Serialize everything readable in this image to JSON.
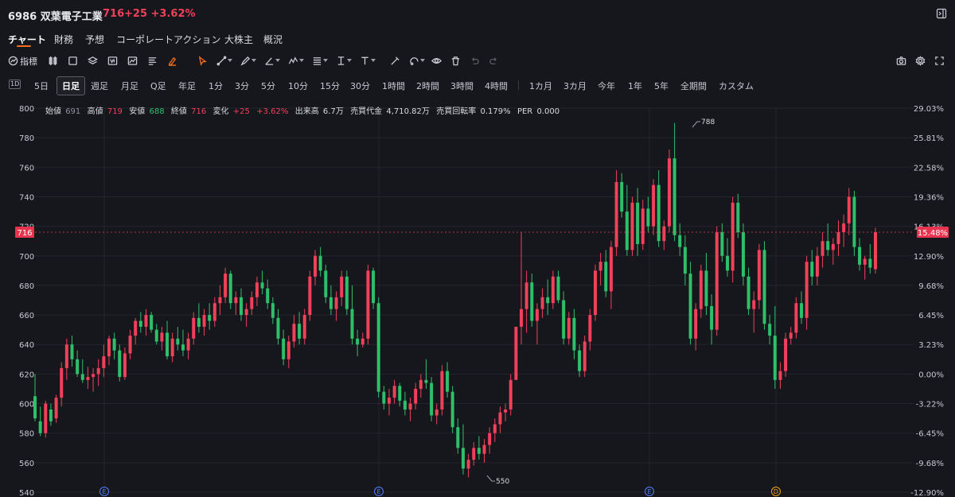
{
  "header": {
    "title": "6986 双葉電子工業",
    "price": "716",
    "change": "+25",
    "change_pct": "+3.62%"
  },
  "tabs": [
    {
      "label": "チャート",
      "active": true
    },
    {
      "label": "財務"
    },
    {
      "label": "予想"
    },
    {
      "label": "コーポレートアクション"
    },
    {
      "label": "大株主"
    },
    {
      "label": "概況"
    }
  ],
  "toolbar": {
    "indicator_label": "指標",
    "icons": [
      "indicator-icon",
      "candle-type-icon",
      "rectangle-icon",
      "layers-icon",
      "template-icon",
      "compare-icon",
      "text-list-icon",
      "brush-icon",
      "cursor-icon",
      "trendline-icon",
      "pen-icon",
      "angle-icon",
      "pattern-icon",
      "fib-icon",
      "measure-icon",
      "text-tool-icon",
      "draw-icon",
      "eye-icon",
      "trash-icon",
      "undo-icon",
      "redo-icon"
    ],
    "right_icons": [
      "camera-icon",
      "settings-icon",
      "fullscreen-icon"
    ]
  },
  "periods": {
    "badge": "1D",
    "items": [
      "5日",
      "日足",
      "週足",
      "月足",
      "Q足",
      "年足",
      "1分",
      "3分",
      "5分",
      "10分",
      "15分",
      "30分",
      "1時間",
      "2時間",
      "3時間",
      "4時間",
      "1カ月",
      "3カ月",
      "今年",
      "1年",
      "5年",
      "全期間",
      "カスタム"
    ],
    "active": "日足"
  },
  "ohlc": {
    "open_label": "始値",
    "open": "691",
    "high_label": "高値",
    "high": "719",
    "low_label": "安値",
    "low": "688",
    "close_label": "終値",
    "close": "716",
    "change_label": "変化",
    "change": "+25",
    "change_pct": "+3.62%",
    "volume_label": "出来高",
    "volume": "6.7万",
    "turnover_label": "売買代金",
    "turnover": "4,710.82万",
    "turnover_rate_label": "売買回転率",
    "turnover_rate": "0.179%",
    "per_label": "PER",
    "per": "0.000"
  },
  "chart_data": {
    "type": "candlestick",
    "y_ticks": [
      800,
      780,
      760,
      740,
      720,
      700,
      680,
      660,
      640,
      620,
      600,
      580,
      560,
      540
    ],
    "pct_ticks": [
      "29.03%",
      "25.81%",
      "22.58%",
      "19.36%",
      "16.13%",
      "12.90%",
      "9.68%",
      "6.45%",
      "3.23%",
      "0.00%",
      "-3.22%",
      "-6.45%",
      "-9.68%",
      "-12.90%"
    ],
    "ylim": [
      540,
      800
    ],
    "current_price": 716,
    "current_label": "716",
    "current_pct": "15.48%",
    "high_marker": "788",
    "low_marker": "550",
    "event_markers": [
      "E",
      "E",
      "E",
      "D"
    ],
    "colors": {
      "up": "#f0405a",
      "down": "#2fbf6a",
      "bg": "#16171c",
      "grid": "#23252c"
    },
    "candles": [
      [
        605,
        620,
        588,
        590
      ],
      [
        588,
        598,
        578,
        580
      ],
      [
        580,
        602,
        577,
        600
      ],
      [
        596,
        600,
        585,
        588
      ],
      [
        590,
        606,
        587,
        604
      ],
      [
        604,
        628,
        598,
        624
      ],
      [
        624,
        644,
        616,
        640
      ],
      [
        640,
        646,
        625,
        630
      ],
      [
        630,
        636,
        618,
        620
      ],
      [
        620,
        630,
        614,
        616
      ],
      [
        616,
        625,
        610,
        618
      ],
      [
        618,
        624,
        608,
        620
      ],
      [
        620,
        630,
        612,
        624
      ],
      [
        624,
        640,
        618,
        632
      ],
      [
        632,
        646,
        626,
        644
      ],
      [
        644,
        648,
        630,
        636
      ],
      [
        636,
        640,
        615,
        618
      ],
      [
        618,
        638,
        616,
        634
      ],
      [
        634,
        650,
        630,
        646
      ],
      [
        646,
        658,
        640,
        656
      ],
      [
        656,
        662,
        648,
        652
      ],
      [
        652,
        664,
        646,
        660
      ],
      [
        660,
        662,
        648,
        650
      ],
      [
        650,
        654,
        640,
        642
      ],
      [
        642,
        652,
        636,
        648
      ],
      [
        648,
        656,
        630,
        632
      ],
      [
        632,
        648,
        628,
        644
      ],
      [
        644,
        652,
        636,
        640
      ],
      [
        640,
        650,
        632,
        636
      ],
      [
        636,
        648,
        630,
        644
      ],
      [
        644,
        662,
        640,
        658
      ],
      [
        658,
        668,
        648,
        652
      ],
      [
        652,
        664,
        646,
        660
      ],
      [
        660,
        668,
        650,
        656
      ],
      [
        656,
        672,
        652,
        668
      ],
      [
        668,
        680,
        660,
        672
      ],
      [
        672,
        692,
        668,
        688
      ],
      [
        688,
        690,
        664,
        668
      ],
      [
        668,
        676,
        660,
        672
      ],
      [
        672,
        678,
        656,
        660
      ],
      [
        660,
        668,
        652,
        664
      ],
      [
        664,
        676,
        660,
        672
      ],
      [
        672,
        686,
        666,
        682
      ],
      [
        682,
        690,
        674,
        678
      ],
      [
        678,
        684,
        664,
        668
      ],
      [
        668,
        672,
        654,
        658
      ],
      [
        658,
        664,
        640,
        644
      ],
      [
        644,
        650,
        626,
        630
      ],
      [
        630,
        646,
        624,
        642
      ],
      [
        642,
        660,
        638,
        654
      ],
      [
        654,
        662,
        640,
        644
      ],
      [
        644,
        664,
        640,
        660
      ],
      [
        660,
        690,
        656,
        686
      ],
      [
        686,
        704,
        680,
        700
      ],
      [
        700,
        706,
        686,
        690
      ],
      [
        690,
        694,
        668,
        672
      ],
      [
        672,
        680,
        660,
        664
      ],
      [
        664,
        676,
        656,
        672
      ],
      [
        672,
        690,
        666,
        686
      ],
      [
        686,
        690,
        660,
        664
      ],
      [
        664,
        680,
        640,
        644
      ],
      [
        644,
        650,
        632,
        640
      ],
      [
        640,
        648,
        638,
        644
      ],
      [
        644,
        694,
        640,
        690
      ],
      [
        690,
        692,
        664,
        668
      ],
      [
        668,
        672,
        604,
        608
      ],
      [
        608,
        612,
        596,
        600
      ],
      [
        600,
        610,
        592,
        604
      ],
      [
        604,
        616,
        600,
        612
      ],
      [
        612,
        614,
        598,
        602
      ],
      [
        602,
        608,
        592,
        596
      ],
      [
        596,
        604,
        588,
        600
      ],
      [
        600,
        614,
        596,
        610
      ],
      [
        610,
        620,
        604,
        616
      ],
      [
        616,
        630,
        610,
        614
      ],
      [
        614,
        618,
        588,
        592
      ],
      [
        592,
        600,
        586,
        596
      ],
      [
        596,
        626,
        592,
        622
      ],
      [
        622,
        628,
        604,
        608
      ],
      [
        608,
        612,
        580,
        584
      ],
      [
        584,
        590,
        566,
        570
      ],
      [
        570,
        586,
        552,
        556
      ],
      [
        556,
        566,
        550,
        562
      ],
      [
        562,
        574,
        558,
        570
      ],
      [
        570,
        578,
        562,
        566
      ],
      [
        566,
        576,
        560,
        572
      ],
      [
        572,
        584,
        566,
        580
      ],
      [
        580,
        590,
        574,
        586
      ],
      [
        586,
        598,
        580,
        594
      ],
      [
        594,
        600,
        588,
        596
      ],
      [
        596,
        620,
        592,
        616
      ],
      [
        616,
        626,
        640,
        652
      ],
      [
        652,
        716,
        640,
        664
      ],
      [
        664,
        690,
        648,
        682
      ],
      [
        682,
        688,
        652,
        656
      ],
      [
        656,
        668,
        640,
        664
      ],
      [
        664,
        678,
        658,
        672
      ],
      [
        672,
        684,
        660,
        668
      ],
      [
        668,
        690,
        664,
        686
      ],
      [
        686,
        690,
        668,
        670
      ],
      [
        670,
        676,
        640,
        644
      ],
      [
        644,
        662,
        640,
        658
      ],
      [
        658,
        664,
        630,
        636
      ],
      [
        636,
        640,
        618,
        622
      ],
      [
        622,
        646,
        618,
        642
      ],
      [
        642,
        664,
        636,
        660
      ],
      [
        660,
        694,
        656,
        690
      ],
      [
        690,
        702,
        680,
        696
      ],
      [
        696,
        704,
        672,
        676
      ],
      [
        676,
        710,
        664,
        706
      ],
      [
        706,
        758,
        700,
        750
      ],
      [
        750,
        756,
        726,
        730
      ],
      [
        730,
        748,
        700,
        704
      ],
      [
        704,
        740,
        700,
        736
      ],
      [
        736,
        746,
        700,
        708
      ],
      [
        708,
        738,
        704,
        732
      ],
      [
        732,
        740,
        716,
        720
      ],
      [
        720,
        752,
        714,
        748
      ],
      [
        748,
        758,
        706,
        710
      ],
      [
        710,
        724,
        704,
        720
      ],
      [
        720,
        772,
        716,
        766
      ],
      [
        766,
        790,
        710,
        714
      ],
      [
        714,
        722,
        700,
        706
      ],
      [
        706,
        714,
        680,
        688
      ],
      [
        688,
        696,
        640,
        644
      ],
      [
        644,
        668,
        636,
        664
      ],
      [
        664,
        694,
        658,
        690
      ],
      [
        690,
        702,
        660,
        666
      ],
      [
        666,
        674,
        640,
        650
      ],
      [
        650,
        720,
        646,
        716
      ],
      [
        716,
        722,
        696,
        700
      ],
      [
        700,
        712,
        686,
        690
      ],
      [
        690,
        740,
        682,
        736
      ],
      [
        736,
        742,
        712,
        716
      ],
      [
        716,
        722,
        680,
        686
      ],
      [
        686,
        692,
        660,
        664
      ],
      [
        664,
        676,
        648,
        670
      ],
      [
        670,
        708,
        664,
        704
      ],
      [
        704,
        710,
        650,
        654
      ],
      [
        654,
        660,
        640,
        646
      ],
      [
        646,
        666,
        610,
        616
      ],
      [
        616,
        628,
        610,
        622
      ],
      [
        622,
        648,
        618,
        644
      ],
      [
        644,
        652,
        640,
        648
      ],
      [
        648,
        672,
        644,
        668
      ],
      [
        668,
        676,
        654,
        658
      ],
      [
        658,
        700,
        650,
        696
      ],
      [
        696,
        704,
        680,
        686
      ],
      [
        686,
        706,
        680,
        700
      ],
      [
        700,
        716,
        692,
        710
      ],
      [
        710,
        722,
        700,
        704
      ],
      [
        704,
        712,
        694,
        708
      ],
      [
        708,
        724,
        700,
        716
      ],
      [
        716,
        728,
        706,
        722
      ],
      [
        722,
        746,
        714,
        740
      ],
      [
        740,
        744,
        700,
        706
      ],
      [
        706,
        712,
        690,
        694
      ],
      [
        694,
        700,
        684,
        698
      ],
      [
        698,
        708,
        688,
        692
      ],
      [
        691,
        719,
        688,
        716
      ]
    ]
  }
}
